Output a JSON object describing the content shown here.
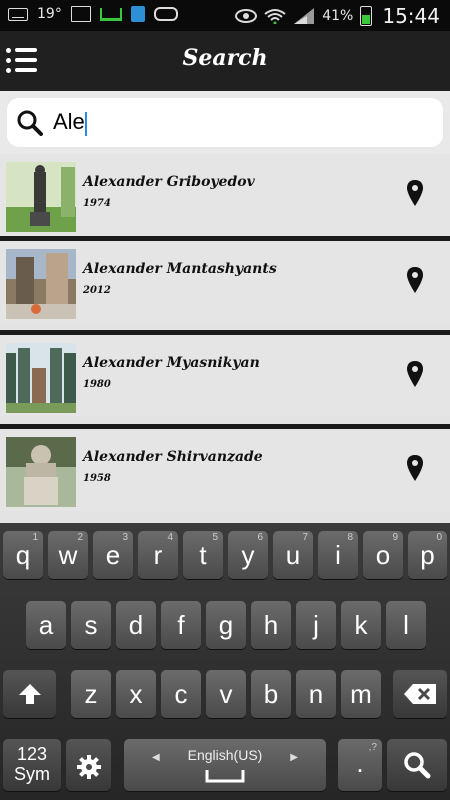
{
  "status_bar": {
    "temperature": "19°",
    "battery_percent": "41%",
    "time": "15:44",
    "left_icons": [
      "keyboard-icon",
      "picture-icon",
      "download-tray-icon",
      "lock-app-icon",
      "voicemail-icon"
    ],
    "right_icons": [
      "eye-icon",
      "wifi-icon",
      "signal-icon",
      "battery-icon"
    ]
  },
  "header": {
    "title": "Search",
    "menu_icon": "list-menu-icon"
  },
  "search": {
    "value": "Ale",
    "icon": "magnifier-icon"
  },
  "results": [
    {
      "name": "Alexander Griboyedov",
      "year": "1974"
    },
    {
      "name": "Alexander Mantashyants",
      "year": "2012"
    },
    {
      "name": "Alexander Myasnikyan",
      "year": "1980"
    },
    {
      "name": "Alexander Shirvanzade",
      "year": "1958"
    }
  ],
  "keyboard": {
    "row1": [
      {
        "k": "q",
        "h": "1"
      },
      {
        "k": "w",
        "h": "2"
      },
      {
        "k": "e",
        "h": "3"
      },
      {
        "k": "r",
        "h": "4"
      },
      {
        "k": "t",
        "h": "5"
      },
      {
        "k": "y",
        "h": "6"
      },
      {
        "k": "u",
        "h": "7"
      },
      {
        "k": "i",
        "h": "8"
      },
      {
        "k": "o",
        "h": "9"
      },
      {
        "k": "p",
        "h": "0"
      }
    ],
    "row2": [
      "a",
      "s",
      "d",
      "f",
      "g",
      "h",
      "j",
      "k",
      "l"
    ],
    "row3": [
      "z",
      "x",
      "c",
      "v",
      "b",
      "n",
      "m"
    ],
    "symbols_key_top": "123",
    "symbols_key_bottom": "Sym",
    "language": "English(US)",
    "period": ".",
    "period_hint": ",?",
    "colors": {
      "accent": "#2a8ee0",
      "battery": "#3cc63c"
    }
  }
}
